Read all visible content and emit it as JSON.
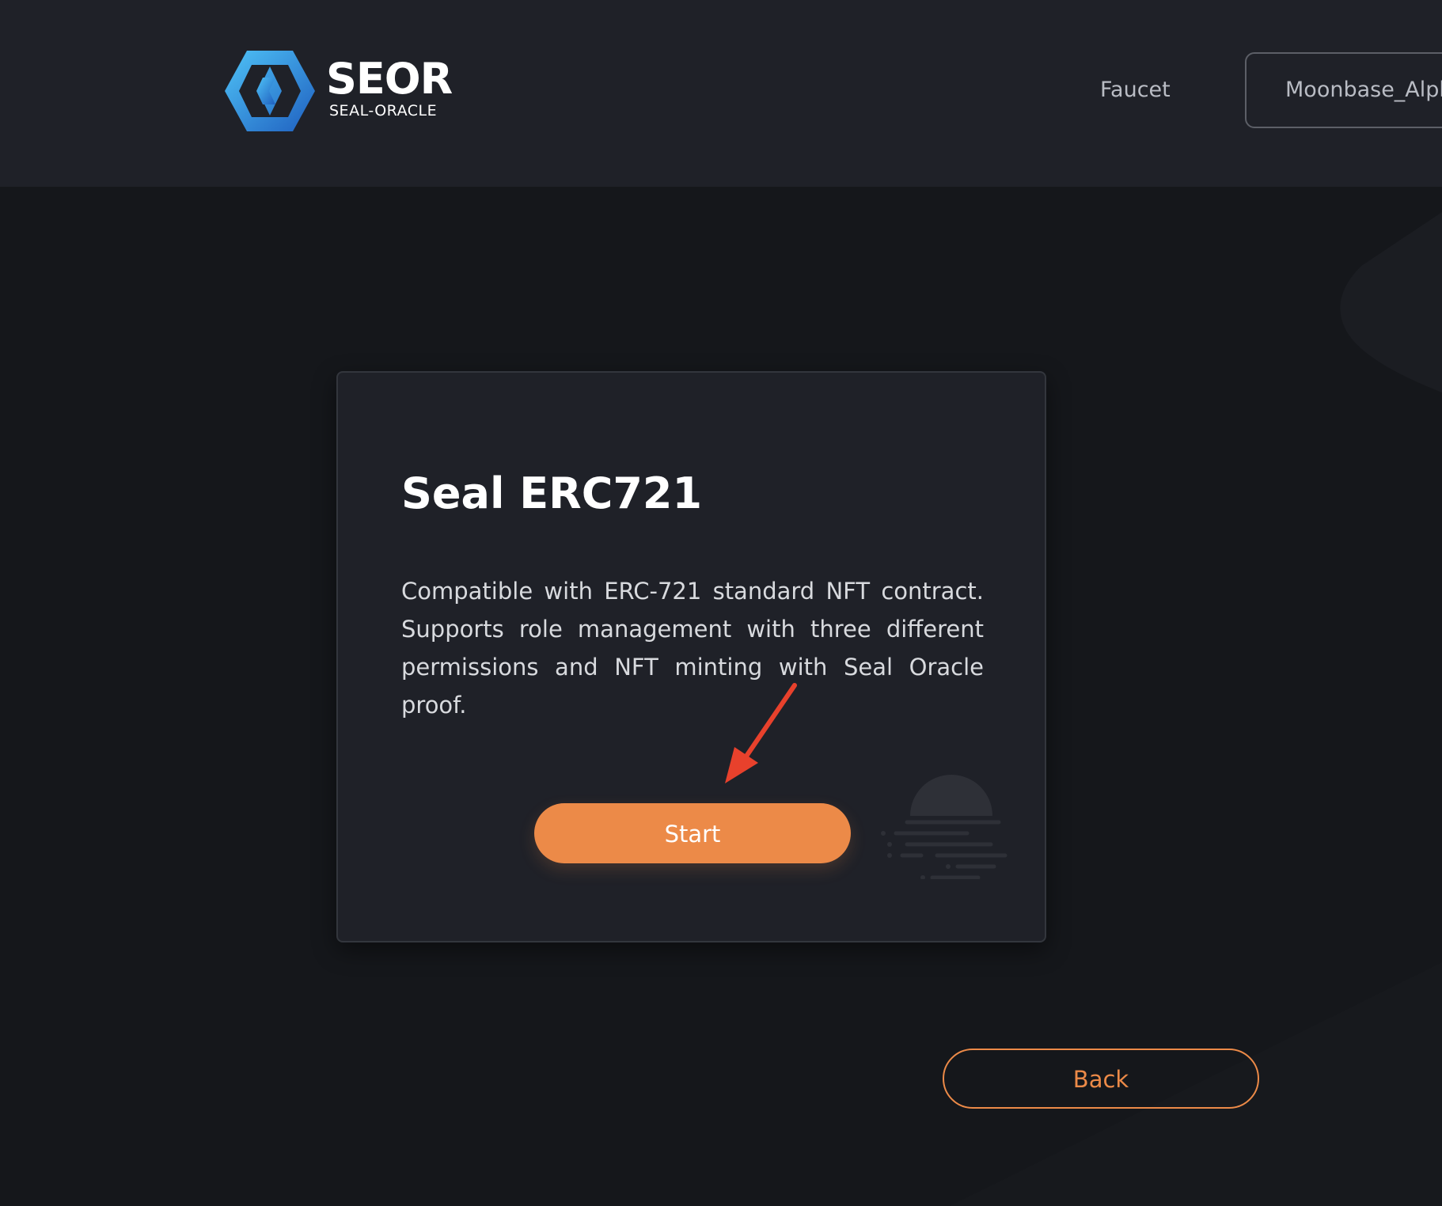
{
  "header": {
    "logo": {
      "title": "SEOR",
      "subtitle": "SEAL-ORACLE"
    },
    "nav": {
      "faucet_label": "Faucet",
      "network_label": "Moonbase_Alpha"
    }
  },
  "card": {
    "title": "Seal ERC721",
    "description": "Compatible with ERC-721 standard NFT contract. Supports role management with three different permissions and NFT minting with Seal Oracle proof.",
    "start_label": "Start"
  },
  "footer": {
    "back_label": "Back"
  },
  "colors": {
    "background": "#15171b",
    "header": "#1f2128",
    "card": "#1f2128",
    "accent": "#ec8a48",
    "annotation_arrow": "#e8412c",
    "logo_blue": "#2f7fd6"
  },
  "icons": {
    "logo": "seor-hexagon-logo-icon",
    "card_illustration": "sunset-lines-icon",
    "annotation": "red-arrow-icon"
  }
}
